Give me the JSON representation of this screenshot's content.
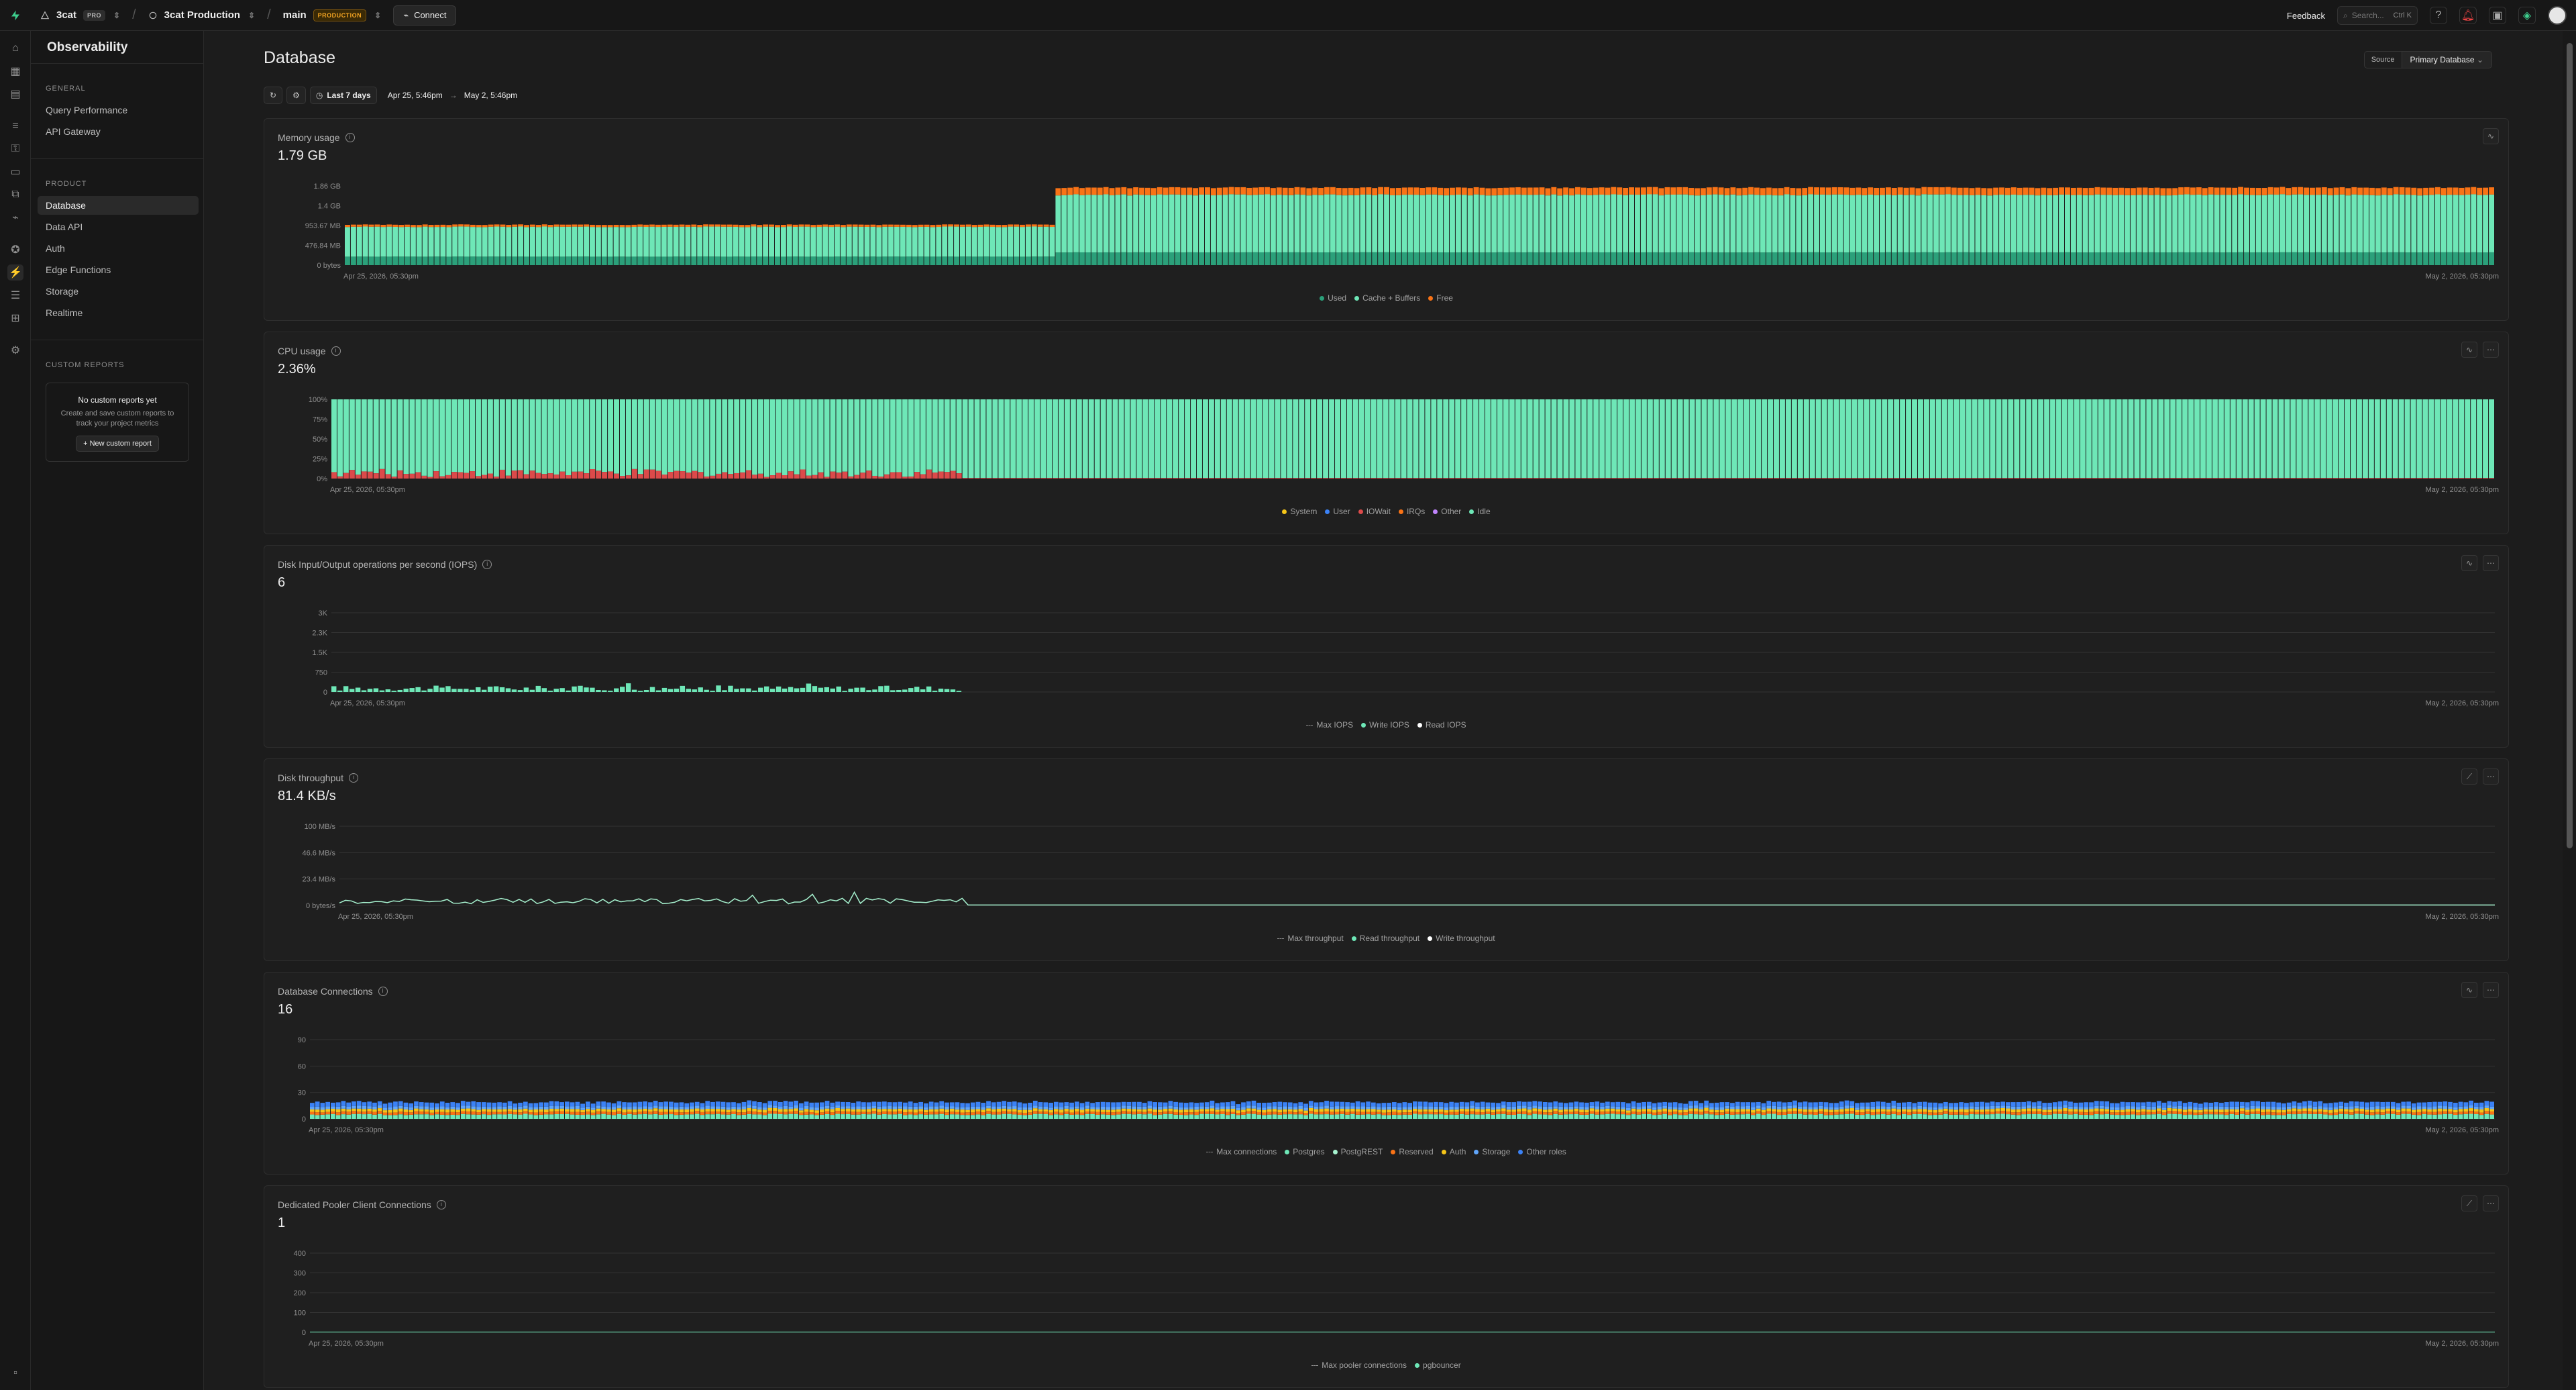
{
  "topbar": {
    "org": "3cat",
    "org_plan": "PRO",
    "project": "3cat Production",
    "branch": "main",
    "branch_badge": "PRODUCTION",
    "connect_label": "Connect",
    "feedback_label": "Feedback",
    "search_placeholder": "Search...",
    "search_shortcut": "Ctrl K"
  },
  "menu": {
    "title": "Observability",
    "general_title": "GENERAL",
    "general_items": [
      "Query Performance",
      "API Gateway"
    ],
    "product_title": "PRODUCT",
    "product_items": [
      "Database",
      "Data API",
      "Auth",
      "Edge Functions",
      "Storage",
      "Realtime"
    ],
    "active_item": "Database",
    "custom_title": "CUSTOM REPORTS",
    "empty_title": "No custom reports yet",
    "empty_desc": "Create and save custom reports to track your project metrics",
    "new_report_label": "New custom report"
  },
  "main": {
    "title": "Database",
    "range_button": "Last 7 days",
    "range_from": "Apr 25, 5:46pm",
    "range_arrow": "→",
    "range_to": "May 2, 5:46pm",
    "source_label": "Source",
    "source_value": "Primary Database"
  },
  "colors": {
    "green": "#6ee7b7",
    "green_dark": "#2ba07a",
    "orange": "#f97316",
    "red": "#dc4a4a",
    "blue": "#3b82f6",
    "yellow": "#f5c518"
  },
  "chart_data": [
    {
      "id": "memory",
      "type": "bar",
      "title": "Memory usage",
      "value": "1.79 GB",
      "y_ticks": [
        "1.86 GB",
        "1.4 GB",
        "953.67 MB",
        "476.84 MB",
        "0 bytes"
      ],
      "x_start": "Apr 25, 2026, 05:30pm",
      "x_end": "May 2, 2026, 05:30pm",
      "legend": [
        "Used",
        "Cache + Buffers",
        "Free"
      ],
      "legend_colors": [
        "#2ba07a",
        "#6ee7b7",
        "#f97316"
      ],
      "series": [
        {
          "name": "Used",
          "segments": [
            {
              "from": 0,
              "to": 0.33,
              "value_gb": 0.2
            },
            {
              "from": 0.33,
              "to": 1,
              "value_gb": 0.3
            }
          ]
        },
        {
          "name": "Cache + Buffers",
          "segments": [
            {
              "from": 0,
              "to": 0.33,
              "value_gb": 0.7
            },
            {
              "from": 0.33,
              "to": 1,
              "value_gb": 1.35
            }
          ]
        },
        {
          "name": "Free",
          "segments": [
            {
              "from": 0,
              "to": 0.33,
              "value_gb": 0.05
            },
            {
              "from": 0.33,
              "to": 1,
              "value_gb": 0.17
            }
          ]
        }
      ],
      "ylim": [
        0,
        1.86
      ]
    },
    {
      "id": "cpu",
      "type": "bar",
      "title": "CPU usage",
      "value": "2.36%",
      "y_ticks": [
        "100%",
        "75%",
        "50%",
        "25%",
        "0%"
      ],
      "x_start": "Apr 25, 2026, 05:30pm",
      "x_end": "May 2, 2026, 05:30pm",
      "legend": [
        "System",
        "User",
        "IOWait",
        "IRQs",
        "Other",
        "Idle"
      ],
      "legend_colors": [
        "#f5c518",
        "#3b82f6",
        "#dc4a4a",
        "#f97316",
        "#c084fc",
        "#6ee7b7"
      ],
      "series": [
        {
          "name": "Idle",
          "value_pct": 97.6
        },
        {
          "name": "User",
          "value_pct_range_active": [
            2,
            12
          ],
          "active_until": 0.29
        }
      ],
      "ylim": [
        0,
        100
      ]
    },
    {
      "id": "iops",
      "type": "bar",
      "title": "Disk Input/Output operations per second (IOPS)",
      "value": "6",
      "y_ticks": [
        "3K",
        "2.3K",
        "1.5K",
        "750",
        "0"
      ],
      "x_start": "Apr 25, 2026, 05:30pm",
      "x_end": "May 2, 2026, 05:30pm",
      "legend": [
        "Max IOPS",
        "Write IOPS",
        "Read IOPS"
      ],
      "legend_colors": [
        "#888888",
        "#6ee7b7",
        "#ffffff"
      ],
      "series": [
        {
          "name": "Write IOPS",
          "range": [
            40,
            320
          ],
          "active_until": 0.29
        }
      ],
      "ylim": [
        0,
        3000
      ]
    },
    {
      "id": "throughput",
      "type": "line",
      "title": "Disk throughput",
      "value": "81.4 KB/s",
      "y_ticks": [
        "100 MB/s",
        "46.6 MB/s",
        "23.4 MB/s",
        "0 bytes/s"
      ],
      "x_start": "Apr 25, 2026, 05:30pm",
      "x_end": "May 2, 2026, 05:30pm",
      "legend": [
        "Max throughput",
        "Read throughput",
        "Write throughput"
      ],
      "legend_colors": [
        "#888888",
        "#6ee7b7",
        "#ffffff"
      ],
      "series": [
        {
          "name": "Write throughput",
          "range_mbs": [
            1,
            12
          ],
          "active_until": 0.29
        }
      ],
      "ylim": [
        0,
        100
      ]
    },
    {
      "id": "connections",
      "type": "bar",
      "title": "Database Connections",
      "value": "16",
      "y_ticks": [
        "90",
        "60",
        "30",
        "0"
      ],
      "x_start": "Apr 25, 2026, 05:30pm",
      "x_end": "May 2, 2026, 05:30pm",
      "legend": [
        "Max connections",
        "Postgres",
        "PostgREST",
        "Reserved",
        "Auth",
        "Storage",
        "Other roles"
      ],
      "legend_colors": [
        "#888888",
        "#6ee7b7",
        "#a7f3d0",
        "#f97316",
        "#f5c518",
        "#60a5fa",
        "#3b82f6"
      ],
      "series": [
        {
          "name": "Postgres",
          "value": 5
        },
        {
          "name": "Reserved",
          "value": 3
        },
        {
          "name": "Auth",
          "value": 3
        },
        {
          "name": "Storage",
          "value": 3
        },
        {
          "name": "Other roles",
          "value": 5
        }
      ],
      "ylim": [
        0,
        90
      ]
    },
    {
      "id": "pooler",
      "type": "line",
      "title": "Dedicated Pooler Client Connections",
      "value": "1",
      "y_ticks": [
        "400",
        "300",
        "200",
        "100",
        "0"
      ],
      "x_start": "Apr 25, 2026, 05:30pm",
      "x_end": "May 2, 2026, 05:30pm",
      "legend": [
        "Max pooler connections",
        "pgbouncer"
      ],
      "legend_colors": [
        "#888888",
        "#6ee7b7"
      ],
      "series": [
        {
          "name": "pgbouncer",
          "value": 1
        }
      ],
      "ylim": [
        0,
        400
      ]
    }
  ]
}
